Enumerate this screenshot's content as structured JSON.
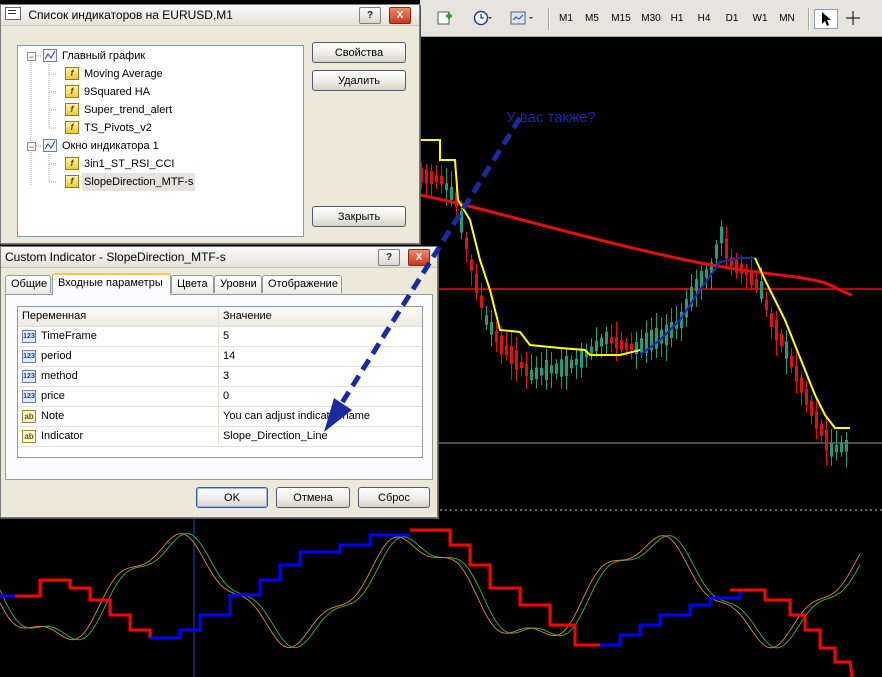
{
  "chart_labels": {
    "annotation": "У вас также?"
  },
  "toolbar": {
    "timeframes": [
      "M1",
      "M5",
      "M15",
      "M30",
      "H1",
      "H4",
      "D1",
      "W1",
      "MN"
    ],
    "icons": [
      "new-chart-icon",
      "clock-icon",
      "template-icon",
      "cursor-icon",
      "crosshair-icon"
    ]
  },
  "indicators_window": {
    "title": "Список индикаторов на EURUSD,M1",
    "help_button": "?",
    "close_button": "X",
    "tree": [
      {
        "label": "Главный график",
        "icon": "chart-window-icon",
        "level": 0
      },
      {
        "label": "Moving Average",
        "icon": "indicator-f-icon",
        "level": 1
      },
      {
        "label": "9Squared HA",
        "icon": "indicator-f-icon",
        "level": 1
      },
      {
        "label": "Super_trend_alert",
        "icon": "indicator-f-icon",
        "level": 1
      },
      {
        "label": "TS_Pivots_v2",
        "icon": "indicator-f-icon",
        "level": 1
      },
      {
        "label": "Окно индикатора 1",
        "icon": "chart-window-icon",
        "level": 0
      },
      {
        "label": "3in1_ST_RSI_CCI",
        "icon": "indicator-f-icon",
        "level": 1
      },
      {
        "label": "SlopeDirection_MTF-s",
        "icon": "indicator-f-icon",
        "level": 1
      }
    ],
    "buttons": {
      "properties": "Свойства",
      "delete": "Удалить",
      "close": "Закрыть"
    }
  },
  "custom_indicator_dialog": {
    "title": "Custom Indicator - SlopeDirection_MTF-s",
    "help_button": "?",
    "close_button": "X",
    "tabs": [
      "Общие",
      "Входные параметры",
      "Цвета",
      "Уровни",
      "Отображение"
    ],
    "active_tab": "Входные параметры",
    "grid_headers": {
      "variable": "Переменная",
      "value": "Значение"
    },
    "params": [
      {
        "name": "TimeFrame",
        "value": "5",
        "type_icon": "123"
      },
      {
        "name": "period",
        "value": "14",
        "type_icon": "123"
      },
      {
        "name": "method",
        "value": "3",
        "type_icon": "123"
      },
      {
        "name": "price",
        "value": "0",
        "type_icon": "123"
      },
      {
        "name": "Note",
        "value": "You can adjust indicator name",
        "type_icon": "ab"
      },
      {
        "name": "Indicator",
        "value": "Slope_Direction_Line",
        "type_icon": "ab"
      }
    ],
    "buttons": {
      "ok": "OK",
      "cancel": "Отмена",
      "reset": "Сброс"
    }
  },
  "colors": {
    "chart_bg": "#000000",
    "bull_candle": "#1e9c7e",
    "bear_candle": "#e01010",
    "moving_average": "#e01010",
    "supertrend_up": "#ffff00",
    "supertrend_down": "#1c2ab0",
    "slope_down": "#ff0000",
    "slope_up": "#0000ff",
    "annotation": "#1c2aa0"
  }
}
